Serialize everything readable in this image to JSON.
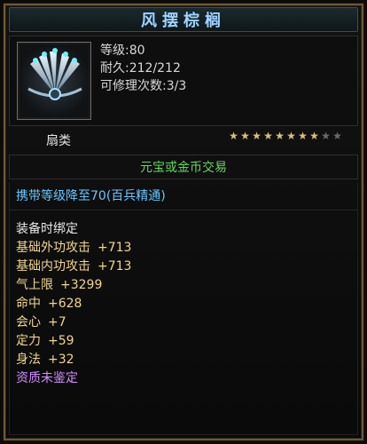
{
  "title": "风摆棕榈",
  "item": {
    "icon": "fan-weapon-icon",
    "stats": [
      "等级:80",
      "耐久:212/212",
      "可修理次数:3/3"
    ]
  },
  "category": {
    "label": "扇类",
    "stars_filled": 8,
    "stars_total": 10
  },
  "trade": "元宝或金币交易",
  "carry_requirement": "携带等级降至70(百兵精通)",
  "bind": "装备时绑定",
  "attributes": [
    {
      "name": "基础外功攻击",
      "value": "+713"
    },
    {
      "name": "基础内功攻击",
      "value": "+713"
    },
    {
      "name": "气上限",
      "value": "+3299"
    },
    {
      "name": "命中",
      "value": "+628"
    },
    {
      "name": "会心",
      "value": "+7"
    },
    {
      "name": "定力",
      "value": "+59"
    },
    {
      "name": "身法",
      "value": "+32"
    }
  ],
  "quality": "资质未鉴定",
  "colors": {
    "title": "#9fd4ff",
    "trade": "#63d85c",
    "carry": "#67c6ff",
    "attr": "#f2d68a",
    "quality": "#d38dff",
    "frame": "#6d5a34"
  }
}
